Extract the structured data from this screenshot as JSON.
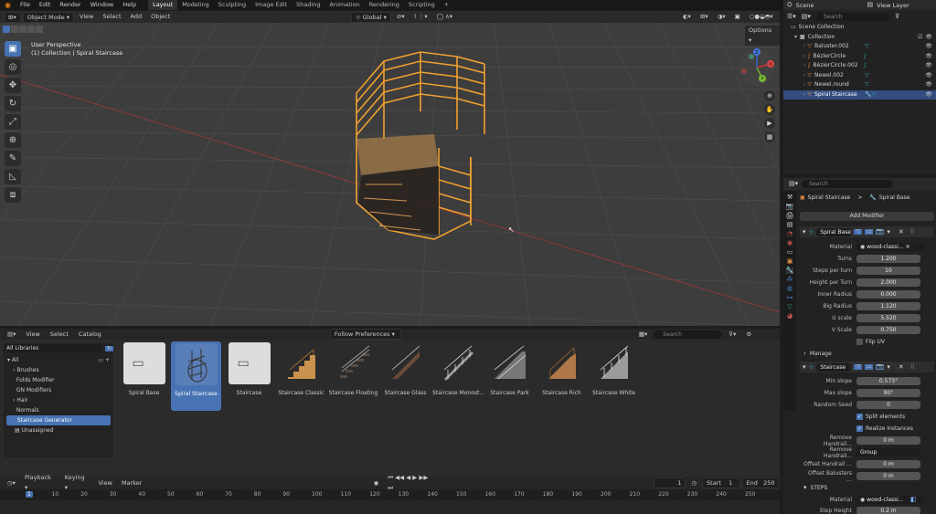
{
  "menu": {
    "items": [
      "File",
      "Edit",
      "Render",
      "Window",
      "Help"
    ]
  },
  "workspaces": {
    "tabs": [
      "Layout",
      "Modeling",
      "Sculpting",
      "Image Edit",
      "Shading",
      "Animation",
      "Rendering",
      "Scripting"
    ],
    "active": "Layout",
    "add": "+"
  },
  "scene": {
    "label": "Scene",
    "view_layer": "View Layer"
  },
  "viewport": {
    "mode": "Object Mode",
    "menus": [
      "View",
      "Select",
      "Add",
      "Object"
    ],
    "transform": "Global",
    "overlay_title": "User Perspective",
    "overlay_sub": "(1) Collection | Spiral Staircase",
    "options": "Options",
    "tools": [
      "▣",
      "◎",
      "✥",
      "↻",
      "⤢",
      "⊕",
      "✎",
      "◺",
      "⧈"
    ],
    "gizmo": {
      "x": "X",
      "y": "Y",
      "z": "Z"
    }
  },
  "outliner": {
    "search_placeholder": "Search",
    "scene_collection": "Scene Collection",
    "collection": "Collection",
    "items": [
      "Baluster.002",
      "BézierCircle",
      "BézierCircle.002",
      "Newel.002",
      "Newel.round",
      "Spiral Staircase"
    ],
    "selected": "Spiral Staircase"
  },
  "properties": {
    "search_placeholder": "Search",
    "breadcrumb_object": "Spiral Staircase",
    "breadcrumb_sep": ">",
    "breadcrumb_modifier": "Spiral Base",
    "add_modifier": "Add Modifier",
    "modifier1": {
      "name": "Spiral Base",
      "material_label": "Material",
      "material_value": "wood-classi...",
      "rows": [
        {
          "label": "Turns",
          "value": "1.200"
        },
        {
          "label": "Steps per turn",
          "value": "10"
        },
        {
          "label": "Height per Turn",
          "value": "2.000"
        },
        {
          "label": "Inner Radius",
          "value": "0.000"
        },
        {
          "label": "Big Radius",
          "value": "1.120"
        },
        {
          "label": "U scale",
          "value": "5.520"
        },
        {
          "label": "V Scale",
          "value": "0.750"
        }
      ],
      "flip_uv": "Flip UV",
      "manage": "Manage"
    },
    "modifier2": {
      "name": "Staircase",
      "rows": [
        {
          "label": "Min slope",
          "value": "0.573°"
        },
        {
          "label": "Max slope",
          "value": "90°"
        },
        {
          "label": "Random Seed",
          "value": "0"
        }
      ],
      "split": "Split elements",
      "realize": "Realize Instances",
      "rows2": [
        {
          "label": "Remove Handrail...",
          "value": "0 m"
        },
        {
          "label": "Remove Handrail...",
          "value": "Group"
        },
        {
          "label": "Offset Handrail ...",
          "value": "0 m"
        },
        {
          "label": "Offset Balusters ...",
          "value": "0 m"
        }
      ],
      "steps": "STEPS",
      "material_label": "Material",
      "material_value": "wood-classi...",
      "step_height": "Step Height",
      "step_height_value": "0.2 m"
    }
  },
  "asset_browser": {
    "menus": [
      "View",
      "Select",
      "Catalog"
    ],
    "import": "Follow Preferences",
    "search_placeholder": "Search",
    "library": "All Libraries",
    "tree": [
      "All",
      "Brushes",
      "Folds Modifier",
      "GN Modifiers",
      "Hair",
      "Normals",
      "Staircase Generator",
      "Unassigned"
    ],
    "active_catalog": "Staircase Generator",
    "assets": [
      "Spiral Base",
      "Spiral Staircase",
      "Staircase",
      "Staircase Classic",
      "Staircase Floating",
      "Staircase Glass",
      "Staircase Monost...",
      "Staircase Park",
      "Staircase Rich",
      "Staircase White"
    ],
    "selected_asset": "Spiral Staircase"
  },
  "timeline": {
    "menus": [
      "Playback",
      "Keying",
      "View",
      "Marker"
    ],
    "current_frame": "1",
    "start_label": "Start",
    "start": "1",
    "end_label": "End",
    "end": "250",
    "ticks": [
      "1",
      "10",
      "20",
      "30",
      "40",
      "50",
      "60",
      "70",
      "80",
      "90",
      "100",
      "110",
      "120",
      "130",
      "140",
      "150",
      "160",
      "170",
      "180",
      "190",
      "200",
      "210",
      "220",
      "230",
      "240",
      "250"
    ]
  },
  "colors": {
    "accent": "#4772b3",
    "selection_outline": "#f0a030",
    "wood": "#c8914e"
  }
}
